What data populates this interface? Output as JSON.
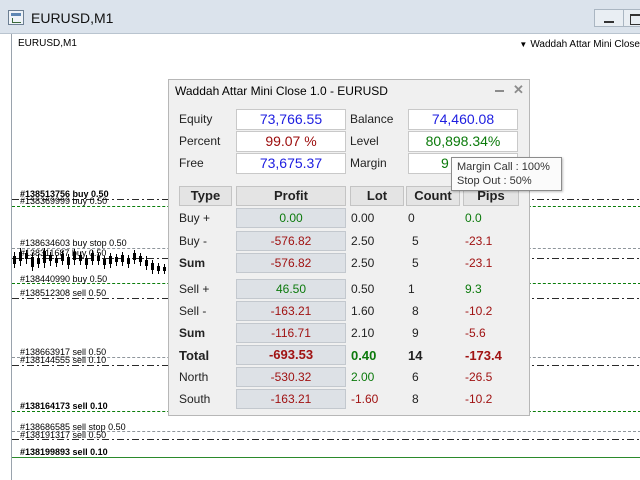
{
  "window": {
    "title": "EURUSD,M1"
  },
  "chart": {
    "symbol_label": "EURUSD,M1",
    "indicator_name": "Waddah Attar Mini Close"
  },
  "orders": [
    {
      "label": "#138513756 buy 0.50",
      "style": "dashdot"
    },
    {
      "label": "#138369999 buy 0.50",
      "style": "green"
    },
    {
      "label": "#138634603 buy stop 0.50",
      "style": "gray"
    },
    {
      "label": "#138311687 buy 0.50",
      "style": "dashdot"
    },
    {
      "label": "#138440990 buy 0.50",
      "style": "green"
    },
    {
      "label": "#138512308 sell 0.50",
      "style": "dashdot"
    },
    {
      "label": "#138663917 sell 0.50",
      "style": "gray"
    },
    {
      "label": "#138144555 sell 0.10",
      "style": "dashdot"
    },
    {
      "label": "#138164173 sell 0.10",
      "style": "green"
    },
    {
      "label": "#138686585 sell stop 0.50",
      "style": "gray"
    },
    {
      "label": "#138191317 sell 0.50",
      "style": "dashdot"
    },
    {
      "label": "#138199893 sell 0.10",
      "style": "solidgreen"
    }
  ],
  "panel": {
    "title": "Waddah Attar Mini Close 1.0  - EURUSD",
    "equity_label": "Equity",
    "equity_value": "73,766.55",
    "balance_label": "Balance",
    "balance_value": "74,460.08",
    "percent_label": "Percent",
    "percent_value": "99.07 %",
    "level_label": "Level",
    "level_value": "80,898.34%",
    "free_label": "Free",
    "free_value": "73,675.37",
    "margin_label": "Margin",
    "margin_value": "9",
    "headers": {
      "type": "Type",
      "profit": "Profit",
      "lot": "Lot",
      "count": "Count",
      "pips": "Pips"
    },
    "rows": [
      {
        "type": "Buy +",
        "profit": "0.00",
        "lot": "0.00",
        "count": "0",
        "pips": "0.0"
      },
      {
        "type": "Buy -",
        "profit": "-576.82",
        "lot": "2.50",
        "count": "5",
        "pips": "-23.1"
      },
      {
        "type": "Sum",
        "profit": "-576.82",
        "lot": "2.50",
        "count": "5",
        "pips": "-23.1"
      },
      {
        "type": "Sell +",
        "profit": "46.50",
        "lot": "0.50",
        "count": "1",
        "pips": "9.3"
      },
      {
        "type": "Sell -",
        "profit": "-163.21",
        "lot": "1.60",
        "count": "8",
        "pips": "-10.2"
      },
      {
        "type": "Sum",
        "profit": "-116.71",
        "lot": "2.10",
        "count": "9",
        "pips": "-5.6"
      },
      {
        "type": "Total",
        "profit": "-693.53",
        "lot": "0.40",
        "count": "14",
        "pips": "-173.4"
      },
      {
        "type": "North",
        "profit": "-530.32",
        "lot": "2.00",
        "count": "6",
        "pips": "-26.5"
      },
      {
        "type": "South",
        "profit": "-163.21",
        "lot": "-1.60",
        "count": "8",
        "pips": "-10.2"
      }
    ]
  },
  "tooltip": {
    "margin_call": "Margin Call : 100%",
    "stop_out": "Stop Out : 50%"
  }
}
